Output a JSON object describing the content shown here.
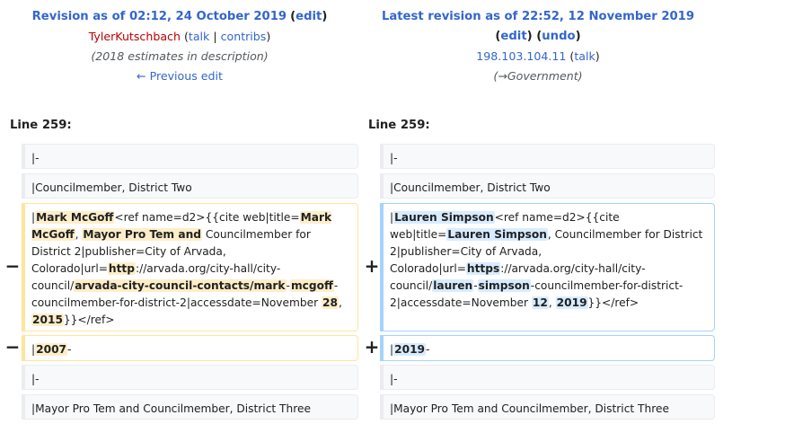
{
  "left_header": {
    "title": "Revision as of 02:12, 24 October 2019",
    "edit": "edit",
    "user": "TylerKutschbach",
    "talk": "talk",
    "contribs": "contribs",
    "summary": "(2018 estimates in description)",
    "prev": "← Previous edit"
  },
  "right_header": {
    "title": "Latest revision as of 22:52, 12 November 2019",
    "edit": "edit",
    "undo": "undo",
    "user": "198.103.104.11",
    "talk": "talk",
    "summary_arrow": "→",
    "summary": "Government"
  },
  "line_left": "Line 259:",
  "line_right": "Line 259:",
  "ctx": {
    "row1": "|-",
    "row2": "|Councilmember, District Two",
    "row7": "|-",
    "row8": "|Mayor Pro Tem and Councilmember, District Three"
  },
  "minus": "−",
  "plus": "+",
  "del": {
    "t1": "|",
    "h1": "Mark McGoff",
    "t2": "<ref name=d2>{{cite web|title=",
    "h2": "Mark McGoff",
    "t3": ", ",
    "h3": "Mayor Pro Tem and",
    "t4": " Councilmember for District 2|publisher=City of Arvada, Colorado|url=",
    "h4": "http",
    "t5": "://arvada.org/city-hall/city-council/",
    "h5": "arvada-city-council-contacts/mark",
    "t6": "-",
    "h6": "mcgoff",
    "t7": "-councilmember-for-district-2|accessdate=November ",
    "h7": "28",
    "t8": ", ",
    "h8": "2015",
    "t9": "}}</ref>"
  },
  "add": {
    "t1": "|",
    "h1": "Lauren Simpson",
    "t2": "<ref name=d2>{{cite web|title=",
    "h2": "Lauren Simpson",
    "t3": ", Councilmember for District 2|publisher=City of Arvada, Colorado|url=",
    "h3": "https",
    "t4": "://arvada.org/city-hall/city-council/",
    "h4": "lauren",
    "t5": "-",
    "h5": "simpson",
    "t6": "-councilmember-for-district-2|accessdate=November ",
    "h6": "12",
    "t7": ", ",
    "h7": "2019",
    "t8": "}}</ref>"
  },
  "del2": {
    "t1": "|",
    "h1": "2007",
    "t2": "-"
  },
  "add2": {
    "t1": "|",
    "h1": "2019",
    "t2": "-"
  }
}
